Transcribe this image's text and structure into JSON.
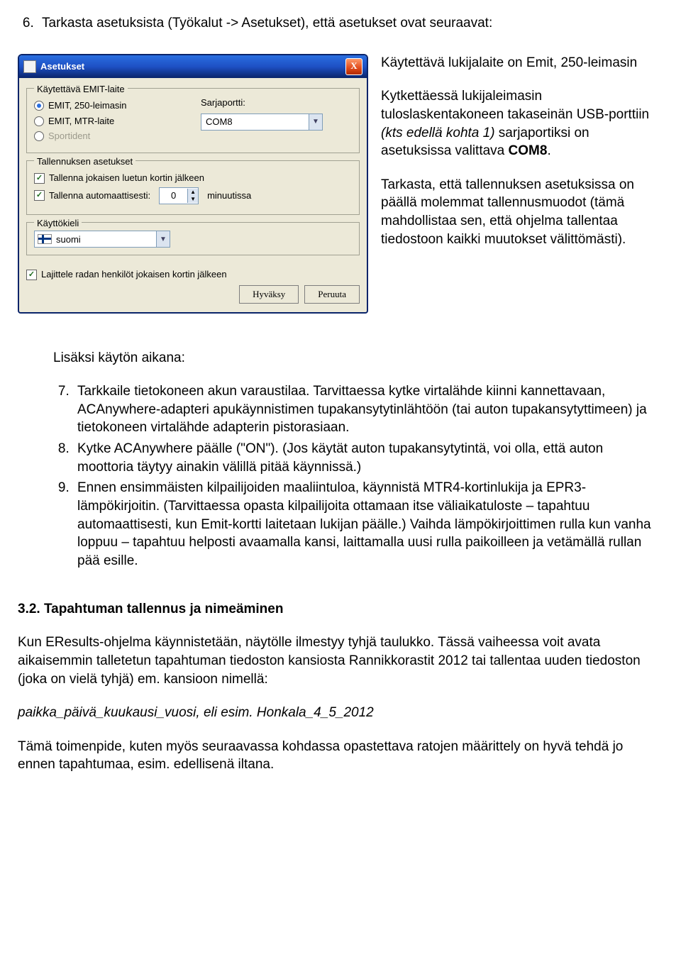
{
  "top_list": {
    "start": 6,
    "item1_a": "Tarkasta asetuksista (Työkalut -> Asetukset), että asetukset ovat seuraavat:"
  },
  "dialog": {
    "title": "Asetukset",
    "close": "X",
    "emit_legend": "Käytettävä EMIT-laite",
    "radios": {
      "r1": "EMIT, 250-leimasin",
      "r2": "EMIT, MTR-laite",
      "r3": "Sportident"
    },
    "serial_label": "Sarjaportti:",
    "serial_value": "COM8",
    "tallennus_legend": "Tallennuksen asetukset",
    "chk1": "Tallenna jokaisen luetun kortin jälkeen",
    "chk2": "Tallenna automaattisesti:",
    "spin_value": "0",
    "spin_suffix": "minuutissa",
    "kieli_legend": "Käyttökieli",
    "kieli_value": "suomi",
    "sort_chk": "Lajittele radan henkilöt jokaisen kortin jälkeen",
    "btn_ok": "Hyväksy",
    "btn_cancel": "Peruuta"
  },
  "side": {
    "p1_a": "Käytettävä lukijalaite on Emit, 250-leimasin",
    "p2_a": "Kytkettäessä lukijaleimasin tuloslaskentakoneen takaseinän USB-porttiin ",
    "p2_b": "(kts edellä kohta 1)",
    "p2_c": " sarjaportiksi on asetuksissa valittava ",
    "p2_d": "COM8",
    "p2_e": ".",
    "p3": "Tarkasta, että tallennuksen asetuksissa on päällä molemmat tallennusmuodot (tämä mahdollistaa sen, että ohjelma tallentaa tiedostoon kaikki muutokset välittömästi)."
  },
  "mid": {
    "intro": "Lisäksi käytön aikana:",
    "li7": "Tarkkaile tietokoneen akun varaustilaa. Tarvittaessa kytke virtalähde kiinni kannettavaan, ACAnywhere-adapteri apukäynnistimen tupakansytytinlähtöön (tai auton tupakansytyttimeen) ja tietokoneen virtalähde adapterin pistorasiaan.",
    "li8": "Kytke ACAnywhere päälle (\"ON\"). (Jos käytät auton tupakansytytintä, voi olla, että auton moottoria täytyy ainakin välillä pitää käynnissä.)",
    "li9": "Ennen ensimmäisten kilpailijoiden maaliintuloa, käynnistä MTR4-kortinlukija ja EPR3-lämpökirjoitin. (Tarvittaessa opasta kilpailijoita ottamaan itse väliaikatuloste – tapahtuu automaattisesti, kun Emit-kortti laitetaan lukijan päälle.) Vaihda lämpökirjoittimen rulla kun vanha loppuu – tapahtuu helposti avaamalla kansi, laittamalla uusi rulla paikoilleen ja vetämällä rullan pää esille."
  },
  "section": {
    "heading": "3.2. Tapahtuman tallennus ja nimeäminen",
    "p1": "Kun EResults-ohjelma käynnistetään, näytölle ilmestyy tyhjä taulukko. Tässä vaiheessa voit avata aikaisemmin talletetun tapahtuman tiedoston kansiosta Rannikkorastit 2012 tai tallentaa uuden tiedoston (joka on vielä tyhjä) em. kansioon nimellä:",
    "p2": "paikka_päivä_kuukausi_vuosi, eli esim. Honkala_4_5_2012",
    "p3": "Tämä toimenpide, kuten myös seuraavassa kohdassa opastettava ratojen määrittely on hyvä tehdä jo ennen tapahtumaa, esim. edellisenä iltana."
  }
}
